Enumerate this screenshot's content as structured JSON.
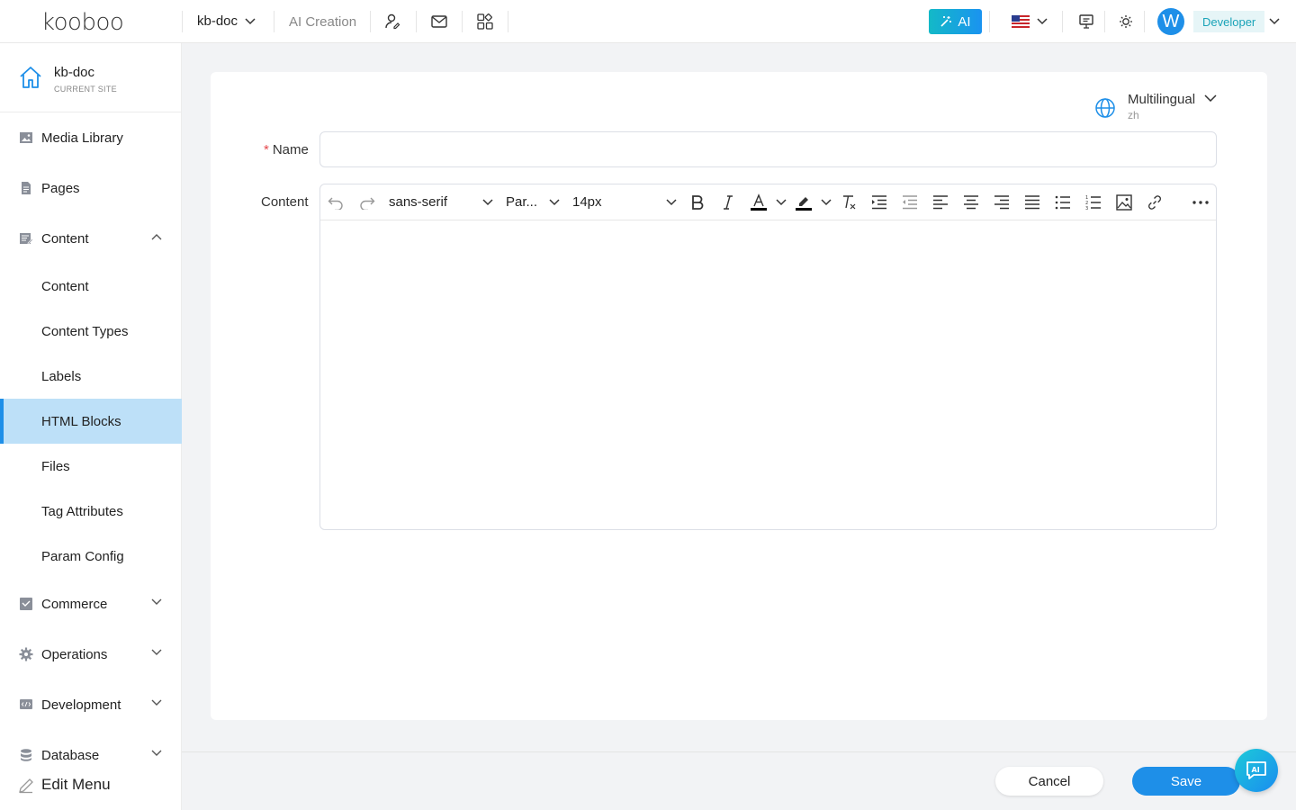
{
  "header": {
    "logo": "kooboo",
    "site_select": "kb-doc",
    "ai_creation": "AI Creation",
    "ai_button": "AI",
    "language_flag": "us-flag",
    "avatar_letter": "W",
    "role": "Developer"
  },
  "sidebar": {
    "site_name": "kb-doc",
    "site_caption": "CURRENT SITE",
    "items": [
      {
        "label": "Media Library",
        "icon": "image-icon"
      },
      {
        "label": "Pages",
        "icon": "page-icon"
      },
      {
        "label": "Content",
        "icon": "content-icon",
        "expanded": true
      },
      {
        "label": "Content"
      },
      {
        "label": "Content Types"
      },
      {
        "label": "Labels"
      },
      {
        "label": "HTML Blocks",
        "active": true
      },
      {
        "label": "Files"
      },
      {
        "label": "Tag Attributes"
      },
      {
        "label": "Param Config"
      },
      {
        "label": "Commerce",
        "icon": "commerce-icon"
      },
      {
        "label": "Operations",
        "icon": "gear-icon"
      },
      {
        "label": "Development",
        "icon": "code-icon"
      },
      {
        "label": "Database",
        "icon": "database-icon"
      }
    ],
    "edit_menu": "Edit Menu"
  },
  "form": {
    "multilingual_label": "Multilingual",
    "multilingual_value": "zh",
    "name_label": "Name",
    "name_required_mark": "*",
    "name_value": "",
    "content_label": "Content",
    "toolbar": {
      "font_family": "sans-serif",
      "block_format": "Par...",
      "font_size": "14px"
    }
  },
  "footer": {
    "cancel": "Cancel",
    "save": "Save"
  },
  "colors": {
    "accent": "#1e8fe8",
    "active_bg": "#bde0f8",
    "required": "#e5484d"
  }
}
